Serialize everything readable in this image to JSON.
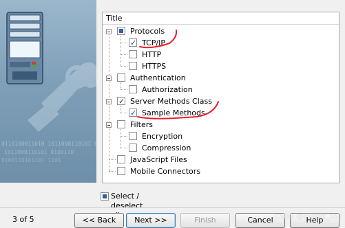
{
  "tree": {
    "header": "Title",
    "items": [
      {
        "label": "Protocols",
        "state": "partial",
        "level": 0
      },
      {
        "label": "TCP/IP",
        "state": "checked",
        "level": 1
      },
      {
        "label": "HTTP",
        "state": "unchecked",
        "level": 1
      },
      {
        "label": "HTTPS",
        "state": "unchecked",
        "level": 1
      },
      {
        "label": "Authentication",
        "state": "unchecked",
        "level": 0
      },
      {
        "label": "Authorization",
        "state": "unchecked",
        "level": 1
      },
      {
        "label": "Server Methods Class",
        "state": "checked",
        "level": 0
      },
      {
        "label": "Sample Methods",
        "state": "checked",
        "level": 1
      },
      {
        "label": "Filters",
        "state": "unchecked",
        "level": 0
      },
      {
        "label": "Encryption",
        "state": "unchecked",
        "level": 1
      },
      {
        "label": "Compression",
        "state": "unchecked",
        "level": 1
      },
      {
        "label": "JavaScript Files",
        "state": "unchecked",
        "level": 0
      },
      {
        "label": "Mobile Connectors",
        "state": "unchecked",
        "level": 0
      }
    ]
  },
  "select_all": {
    "label": "Select / deselect all",
    "state": "partial"
  },
  "footer": {
    "step": "3 of 5",
    "back": "<< Back",
    "next": "Next >>",
    "finish": "Finish",
    "cancel": "Cancel",
    "help": "Help"
  },
  "watermark": "CSDN @mgisfz_567",
  "icons": {
    "left_panel": "computer-wrench-illustration",
    "binary_text": "0110100011010 1011000110101 0100110101101"
  },
  "colors": {
    "annotation": "#e8202a",
    "accent": "#2f5fa8"
  }
}
